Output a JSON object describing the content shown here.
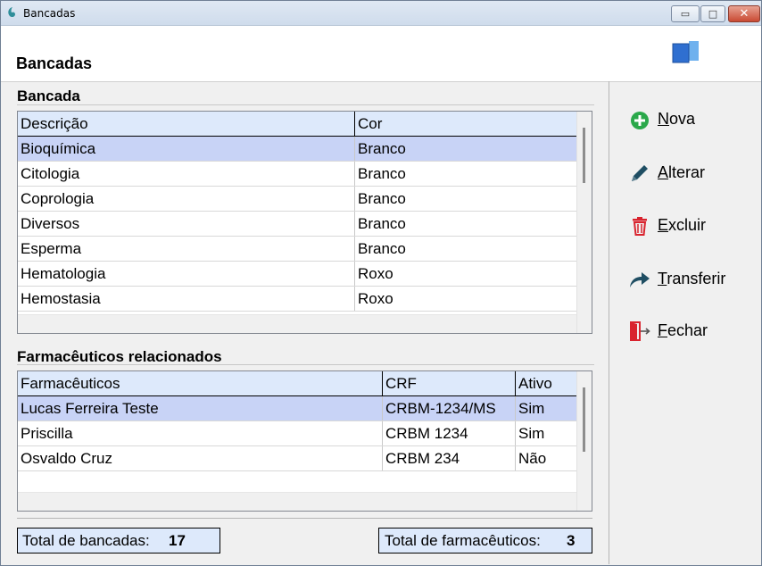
{
  "window": {
    "title": "Bancadas",
    "controls": {
      "minimize": "▭",
      "maximize": "□",
      "close": "✕"
    }
  },
  "header": {
    "title": "Bancadas",
    "icon": "split-panel-icon"
  },
  "bancada": {
    "section_title": "Bancada",
    "columns": [
      "Descrição",
      "Cor"
    ],
    "rows": [
      [
        "Bioquímica",
        "Branco"
      ],
      [
        "Citologia",
        "Branco"
      ],
      [
        "Coprologia",
        "Branco"
      ],
      [
        "Diversos",
        "Branco"
      ],
      [
        "Esperma",
        "Branco"
      ],
      [
        "Hematologia",
        "Roxo"
      ],
      [
        "Hemostasia",
        "Roxo"
      ]
    ],
    "selected_row": 0
  },
  "farmaceuticos": {
    "section_title": "Farmacêuticos relacionados",
    "columns": [
      "Farmacêuticos",
      "CRF",
      "Ativo"
    ],
    "rows": [
      [
        "Lucas Ferreira Teste",
        "CRBM-1234/MS",
        "Sim"
      ],
      [
        "Priscilla",
        "CRBM 1234",
        "Sim"
      ],
      [
        "Osvaldo Cruz",
        "CRBM 234",
        "Não"
      ]
    ],
    "selected_row": 0
  },
  "actions": [
    {
      "key": "nova",
      "underline": "N",
      "rest": "ova",
      "icon": "plus-circle-icon",
      "color": "#2aa84a"
    },
    {
      "key": "alterar",
      "underline": "A",
      "rest": "lterar",
      "icon": "pencil-icon",
      "color": "#1f4e63"
    },
    {
      "key": "excluir",
      "underline": "E",
      "rest": "xcluir",
      "icon": "trash-icon",
      "color": "#d9232e"
    },
    {
      "key": "transferir",
      "underline": "T",
      "rest": "ransferir",
      "icon": "share-arrow-icon",
      "color": "#1f4e63"
    },
    {
      "key": "fechar",
      "underline": "F",
      "rest": "echar",
      "icon": "exit-door-icon",
      "color": "#d9232e"
    }
  ],
  "totals": {
    "bancadas_label": "Total de bancadas:",
    "bancadas_value": "17",
    "farmaceuticos_label": "Total de farmacêuticos:",
    "farmaceuticos_value": "3"
  }
}
